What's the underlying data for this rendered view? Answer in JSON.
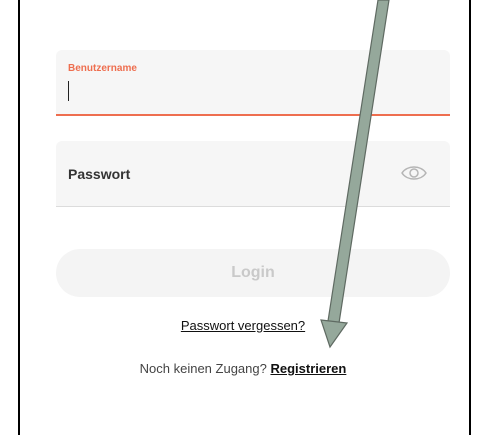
{
  "login_form": {
    "username": {
      "label": "Benutzername",
      "value": ""
    },
    "password": {
      "placeholder": "Passwort",
      "toggle_icon": "eye-icon"
    },
    "login_button_label": "Login",
    "forgot_password_link": "Passwort vergessen?",
    "register_prompt": "Noch keinen Zugang?",
    "register_link": "Registrieren"
  },
  "annotation": {
    "arrow_icon": "arrow-pointer-icon",
    "arrow_color": "#95a89b"
  },
  "colors": {
    "accent": "#ee6e4f",
    "field_background": "#f6f6f6",
    "button_background": "#f4f4f4",
    "button_text_disabled": "#c9c9c9"
  }
}
